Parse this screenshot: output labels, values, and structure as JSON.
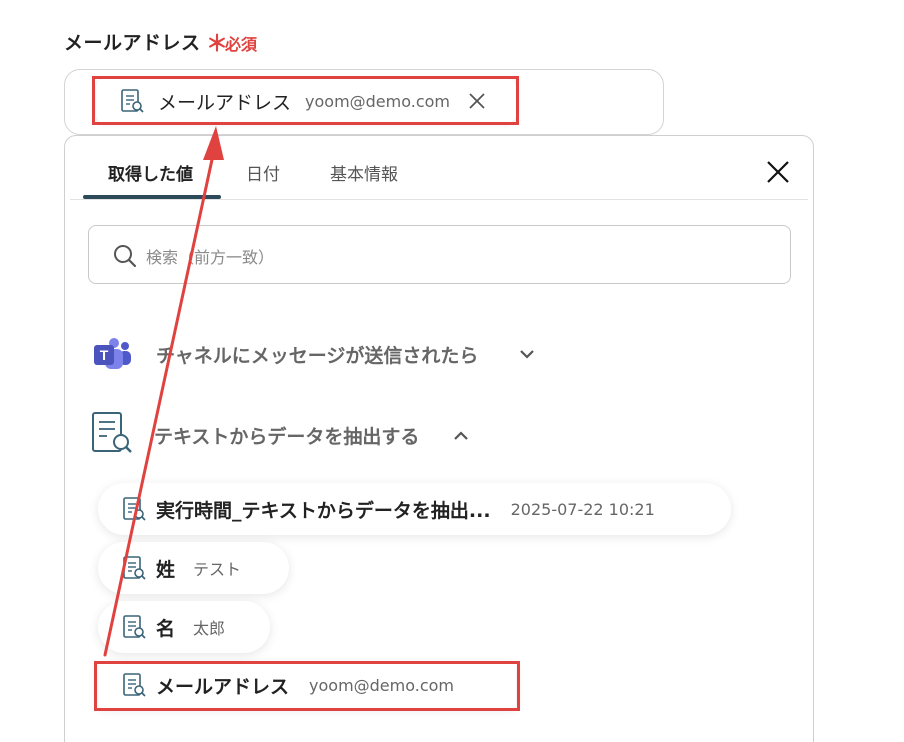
{
  "field": {
    "label": "メールアドレス",
    "required_star": "＊",
    "required_text": "必須"
  },
  "selected_chip": {
    "label": "メールアドレス",
    "value": "yoom@demo.com"
  },
  "tabs": [
    {
      "label": "取得した値",
      "active": true
    },
    {
      "label": "日付",
      "active": false
    },
    {
      "label": "基本情報",
      "active": false
    }
  ],
  "search": {
    "placeholder": "検索（前方一致）"
  },
  "sections": [
    {
      "title": "チャネルにメッセージが送信されたら",
      "expanded": false,
      "icon": "teams-icon"
    },
    {
      "title": "テキストからデータを抽出する",
      "expanded": true,
      "icon": "document-search-icon"
    }
  ],
  "values": [
    {
      "label": "実行時間_テキストからデータを抽出...",
      "value": "2025-07-22 10:21"
    },
    {
      "label": "姓",
      "value": "テスト"
    },
    {
      "label": "名",
      "value": "太郎"
    },
    {
      "label": "メールアドレス",
      "value": "yoom@demo.com"
    }
  ],
  "colors": {
    "accent_red": "#e0433f",
    "tab_underline": "#2c4a5a",
    "teams_purple": "#5b5fc7"
  }
}
